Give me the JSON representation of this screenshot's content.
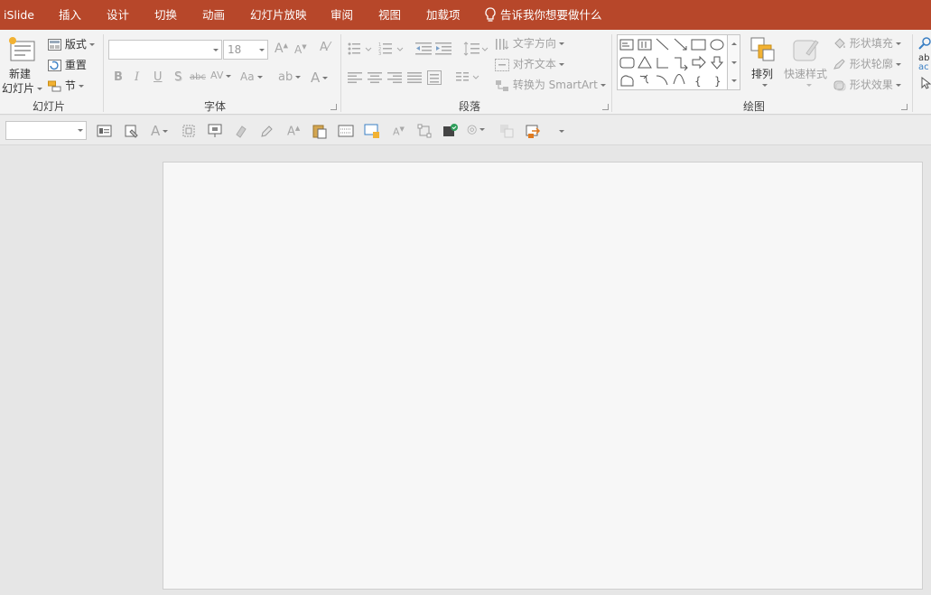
{
  "menu": {
    "tabs": [
      "iSlide",
      "插入",
      "设计",
      "切换",
      "动画",
      "幻灯片放映",
      "审阅",
      "视图",
      "加载项"
    ],
    "tell_me": "告诉我你想要做什么"
  },
  "ribbon": {
    "slides_group": {
      "label": "幻灯片",
      "new_slide_line1": "新建",
      "new_slide_line2": "幻灯片",
      "layout": "版式",
      "reset": "重置",
      "section": "节"
    },
    "font_group": {
      "label": "字体",
      "font_name": "",
      "font_size": "18",
      "bold": "B",
      "italic": "I",
      "underline": "U",
      "shadow": "S",
      "strike": "abc",
      "spacing": "AV",
      "case": "Aa",
      "grow": "A",
      "shrink": "A",
      "color": "A"
    },
    "paragraph_group": {
      "label": "段落",
      "text_direction": "文字方向",
      "align_text": "对齐文本",
      "smartart": "转换为 SmartArt"
    },
    "drawing_group": {
      "label": "绘图",
      "arrange": "排列",
      "quick_styles": "快速样式",
      "shape_fill": "形状填充",
      "shape_outline": "形状轮廓",
      "shape_effects": "形状效果"
    },
    "editing_partial": [
      "ab",
      "ac"
    ]
  },
  "quick_toolbar": {
    "combo_value": ""
  },
  "colors": {
    "accent": "#b7472a",
    "ribbon_bg": "#f3f3f3",
    "workspace_bg": "#e6e6e6",
    "slide_bg": "#f7f7f7"
  }
}
